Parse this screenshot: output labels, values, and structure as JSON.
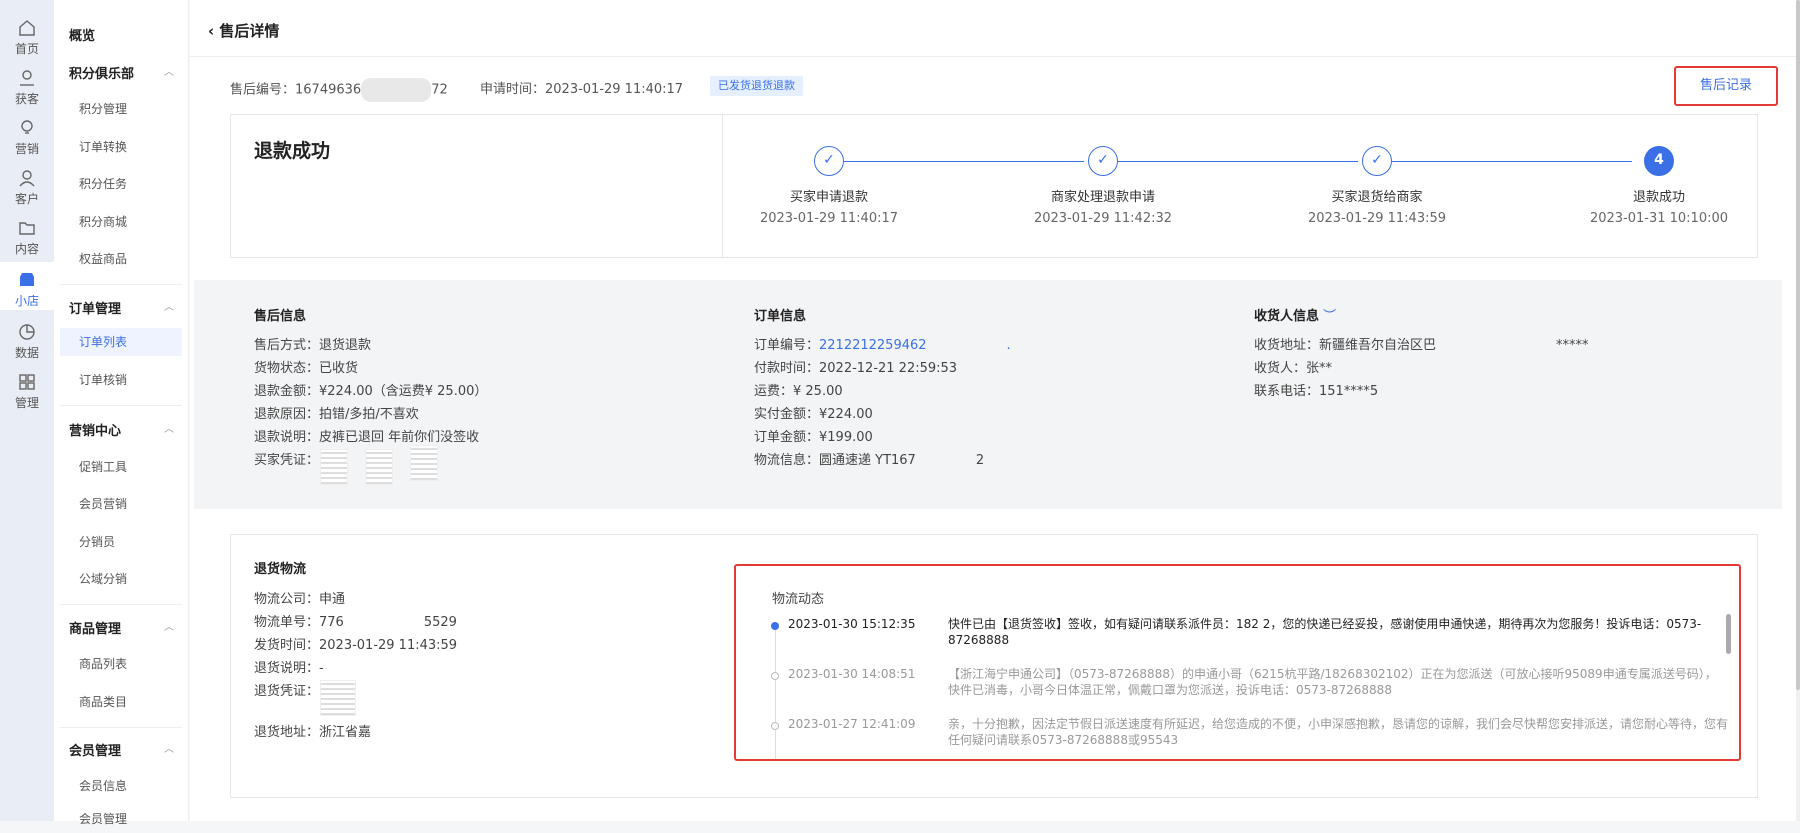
{
  "nav1": [
    {
      "label": "首页",
      "icon": "home-icon"
    },
    {
      "label": "获客",
      "icon": "acquire-icon"
    },
    {
      "label": "营销",
      "icon": "bulb-icon"
    },
    {
      "label": "客户",
      "icon": "user-icon"
    },
    {
      "label": "内容",
      "icon": "folder-icon"
    },
    {
      "label": "小店",
      "icon": "shop-icon"
    },
    {
      "label": "数据",
      "icon": "chart-icon"
    },
    {
      "label": "管理",
      "icon": "grid-icon"
    }
  ],
  "nav2": {
    "overview": "概览",
    "g1": {
      "title": "积分俱乐部",
      "items": [
        "积分管理",
        "订单转换",
        "积分任务",
        "积分商城",
        "权益商品"
      ]
    },
    "g2": {
      "title": "订单管理",
      "items": [
        "订单列表",
        "订单核销"
      ]
    },
    "g3": {
      "title": "营销中心",
      "items": [
        "促销工具",
        "会员营销",
        "分销员",
        "公域分销"
      ]
    },
    "g4": {
      "title": "商品管理",
      "items": [
        "商品列表",
        "商品类目"
      ]
    },
    "g5": {
      "title": "会员管理",
      "items": [
        "会员信息",
        "会员管理"
      ]
    }
  },
  "page": {
    "title": "售后详情",
    "aftersale_no_label": "售后编号：",
    "aftersale_no_a": "16749636",
    "aftersale_no_b": "72",
    "apply_time": "申请时间：2023-01-29 11:40:17",
    "status_tag": "已发货退货退款",
    "record_btn": "售后记录"
  },
  "progress": {
    "result": "退款成功",
    "steps": [
      {
        "n": "✓",
        "label": "买家申请退款",
        "time": "2023-01-29 11:40:17"
      },
      {
        "n": "✓",
        "label": "商家处理退款申请",
        "time": "2023-01-29 11:42:32"
      },
      {
        "n": "✓",
        "label": "买家退货给商家",
        "time": "2023-01-29 11:43:59"
      },
      {
        "n": "4",
        "label": "退款成功",
        "time": "2023-01-31 10:10:00"
      }
    ]
  },
  "aftersale": {
    "title": "售后信息",
    "rows": [
      "售后方式：退货退款",
      "货物状态：已收货",
      "退款金额：¥224.00（含运费¥ 25.00）",
      "退款原因：拍错/多拍/不喜欢",
      "退款说明：皮裤已退回 年前你们没签收"
    ],
    "proof_label": "买家凭证："
  },
  "order": {
    "title": "订单信息",
    "no_label": "订单编号：",
    "no_value": "2212212259462",
    "no_tail": ".",
    "rows": [
      "付款时间：2022-12-21 22:59:53",
      "运费：¥ 25.00",
      "实付金额：¥224.00",
      "订单金额：¥199.00"
    ],
    "logistics": "物流信息：圆通速递 YT167",
    "logistics_tail": "2"
  },
  "receiver": {
    "title": "收货人信息",
    "addr": "收货地址：新疆维吾尔自治区巴",
    "addr_tail": "*****",
    "name": "收货人：张**",
    "phone": "联系电话：151****5"
  },
  "return": {
    "title": "退货物流",
    "company": "物流公司：申通",
    "no": "物流单号：776",
    "no_tail": "5529",
    "time": "发货时间：2023-01-29 11:43:59",
    "note": "退货说明：-",
    "proof": "退货凭证：",
    "addr": "退货地址：浙江省嘉"
  },
  "log": {
    "title": "物流动态",
    "events": [
      {
        "time": "2023-01-30 15:12:35",
        "text": "快件已由【退货签收】签收，如有疑问请联系派件员：182 2，您的快递已经妥投，感谢使用申通快递，期待再次为您服务！投诉电话：0573-87268888"
      },
      {
        "time": "2023-01-30 14:08:51",
        "text": "【浙江海宁申通公司】（0573-87268888）的申通小哥（6215杭平路/18268302102）正在为您派送（可放心接听95089申通专属派送号码），快件已消毒，小哥今日体温正常，佩戴口罩为您派送，投诉电话：0573-87268888"
      },
      {
        "time": "2023-01-27 12:41:09",
        "text": "亲，十分抱歉，因法定节假日派送速度有所延迟，给您造成的不便，小申深感抱歉，恳请您的谅解，我们会尽快帮您安排派送，请您耐心等待，您有任何疑问请联系0573-87268888或95543"
      }
    ]
  },
  "colors": {
    "accent": "#3b6fe6",
    "highlight": "#e53935"
  }
}
